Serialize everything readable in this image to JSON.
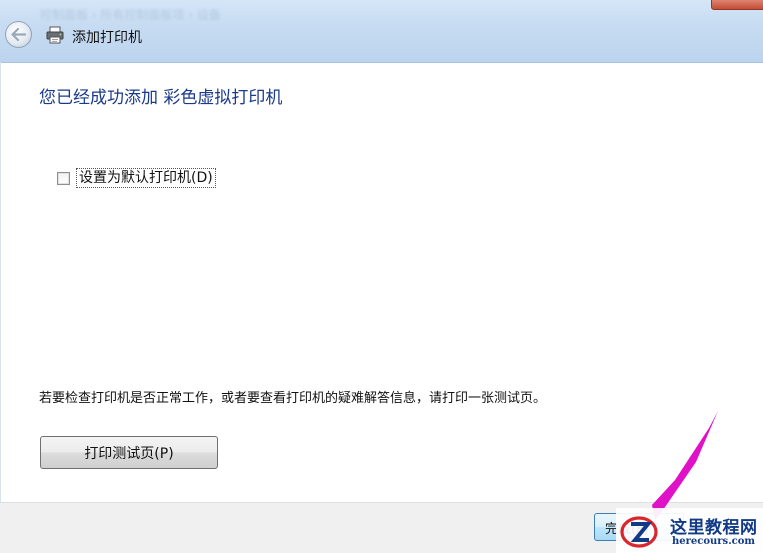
{
  "window": {
    "ghost_title": "控制面板 › 所有控制面板项 › 设备",
    "title": "添加打印机"
  },
  "header": {
    "back_icon": "back-arrow-icon",
    "printer_icon": "printer-icon"
  },
  "main": {
    "heading": "您已经成功添加 彩色虚拟打印机",
    "default_printer_checkbox": {
      "label": "设置为默认打印机(D)",
      "checked": false
    },
    "info_text": "若要检查打印机是否正常工作，或者要查看打印机的疑难解答信息，请打印一张测试页。",
    "print_test_button": "打印测试页(P)"
  },
  "footer": {
    "finish_button": "完成(F)"
  },
  "watermark": {
    "name": "这里教程网",
    "url": "herecours.com"
  },
  "colors": {
    "heading": "#1a3a8a",
    "arrow": "#e012c8",
    "watermark": "#123a86"
  }
}
